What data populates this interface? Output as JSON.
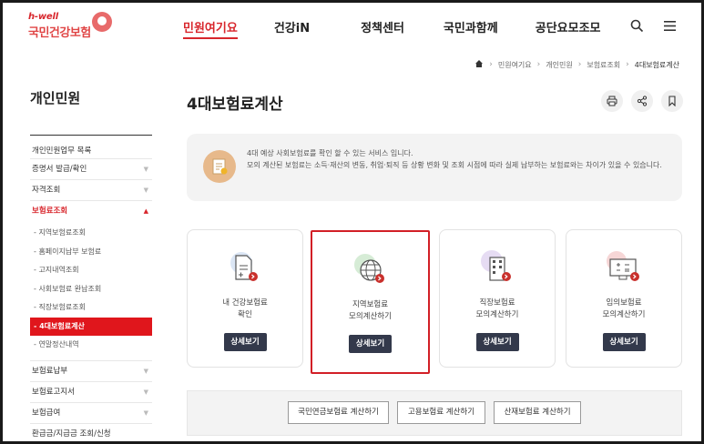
{
  "header": {
    "logo_small": "h-well",
    "logo_main": "국민건강보험",
    "nav": [
      {
        "label": "민원여기요",
        "active": true
      },
      {
        "label": "건강iN",
        "active": false
      },
      {
        "label": "정책센터",
        "active": false
      },
      {
        "label": "국민과함께",
        "active": false
      },
      {
        "label": "공단요모조모",
        "active": false
      }
    ]
  },
  "breadcrumb": [
    "민원여기요",
    "개인민원",
    "보험료조회",
    "4대보험료계산"
  ],
  "sidebar": {
    "title": "개인민원",
    "items_before": [
      "개인민원업무 목록",
      "증명서 발급/확인",
      "자격조회"
    ],
    "open_item": "보험료조회",
    "sub_items": [
      "지역보험료조회",
      "홈페이지납부 보험료",
      "고지내역조회",
      "사회보험료 완납조회",
      "직장보험료조회",
      "4대보험료계산",
      "연말정산내역"
    ],
    "active_sub_index": 5,
    "items_after": [
      "보험료납부",
      "보험료고지서",
      "보험급여",
      "환급금/지급금 조회/신청"
    ]
  },
  "main": {
    "title": "4대보험료계산",
    "info_lines": [
      "4대 예상 사회보험료를 확인 할 수 있는 서비스 입니다.",
      "모의 계산된 보험료는 소득·재산의 변동, 취업·퇴직 등 상황 변화 및 조회 시점에 따라 실제 납부하는 보험료와는 차이가 있을 수 있습니다."
    ],
    "cards": [
      {
        "line1": "내 건강보험료",
        "line2": "확인",
        "button": "상세보기",
        "icon": "document-icon"
      },
      {
        "line1": "지역보험료",
        "line2": "모의계산하기",
        "button": "상세보기",
        "icon": "globe-icon"
      },
      {
        "line1": "직장보험료",
        "line2": "모의계산하기",
        "button": "상세보기",
        "icon": "building-icon"
      },
      {
        "line1": "임의보험료",
        "line2": "모의계산하기",
        "button": "상세보기",
        "icon": "calculator-icon"
      }
    ],
    "calc_buttons": [
      "국민연금보험료 계산하기",
      "고용보험료 계산하기",
      "산재보험료 계산하기"
    ]
  },
  "colors": {
    "accent": "#d8262c",
    "button_dark": "#33394b"
  }
}
